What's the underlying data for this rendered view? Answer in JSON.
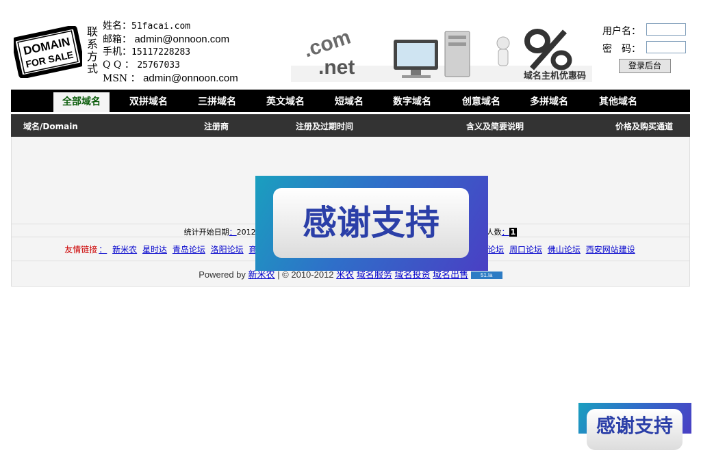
{
  "header": {
    "logo_text": [
      "DOMAIN",
      "FOR SALE"
    ],
    "contact_vertical": "联系方式",
    "contact": [
      {
        "label": "姓名：",
        "value": "51facai.com"
      },
      {
        "label": "邮箱：",
        "value": "admin@onnoon.com"
      },
      {
        "label": "手机：",
        "value": "15117228283"
      },
      {
        "label": "Q Q ：",
        "value": "25767033"
      },
      {
        "label": "MSN ：",
        "value": "admin@onnoon.com"
      }
    ],
    "banner_text": "域名主机优惠码",
    "banner_dotcom": ".com",
    "banner_net": ".net"
  },
  "login": {
    "username_label": "用户名：",
    "password_label": "密　码：",
    "button_label": "登录后台"
  },
  "nav": {
    "items": [
      "全部域名",
      "双拼域名",
      "三拼域名",
      "英文域名",
      "短域名",
      "数字域名",
      "创意域名",
      "多拼域名",
      "其他域名"
    ],
    "active_index": 0
  },
  "table_header": [
    "域名/Domain",
    "注册商",
    "注册及过期时间",
    "含义及简要说明",
    "价格及购买通道"
  ],
  "stats": {
    "start_label": "统计开始日期",
    "colon": "：",
    "start_value": "2012",
    "visitors_label": "人数",
    "visitors_value": "1"
  },
  "links": {
    "label": "友情链接",
    "colon": "：",
    "left_items": [
      "新米农",
      "星时达",
      "青岛论坛",
      "洛阳论坛",
      "商"
    ],
    "right_items": [
      "论坛",
      "周口论坛",
      "佛山论坛",
      "西安网站建设"
    ]
  },
  "footer": {
    "powered_by": "Powered by",
    "brand": "新米农",
    "copyright": "| © 2010-2012",
    "links": [
      "米农",
      "域名服务",
      "域名投资",
      "域名出售"
    ],
    "badge": "51.la"
  },
  "popup": {
    "text": "感谢支持"
  },
  "colors": {
    "nav_bg": "#000000",
    "thead_bg": "#333333",
    "content_bg": "#f4f4f4",
    "active_tab_text": "#0a5c0a",
    "link": "#0000cc",
    "link_label": "#cc0000"
  }
}
